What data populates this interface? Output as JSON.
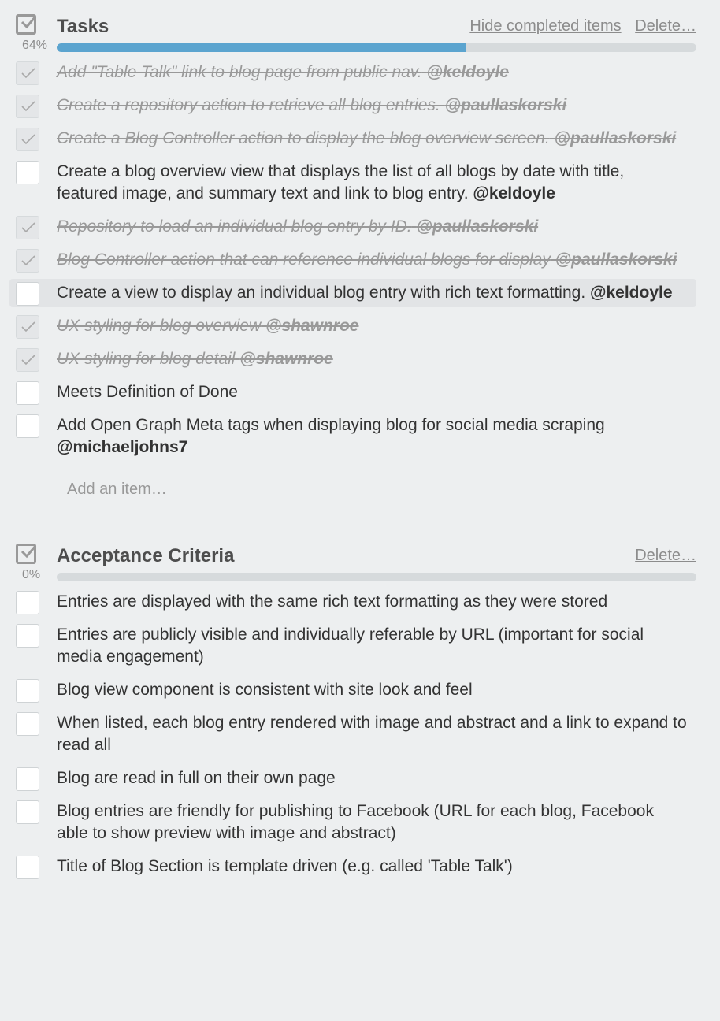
{
  "tasks": {
    "title": "Tasks",
    "hide_completed": "Hide completed items",
    "delete": "Delete…",
    "percent": "64%",
    "progress": 64,
    "items": [
      {
        "text": "Add \"Table Talk\" link to blog page from public nav.",
        "mention": "@keldoyle",
        "done": true
      },
      {
        "text": "Create a repository action to retrieve all blog entries.",
        "mention": "@paullaskorski",
        "done": true
      },
      {
        "text": "Create a Blog Controller action to display the blog overview screen.",
        "mention": "@paullaskorski",
        "done": true
      },
      {
        "text": "Create a blog overview view that displays the list of all blogs by date with title, featured image, and summary text and link to blog entry.",
        "mention": "@keldoyle",
        "done": false
      },
      {
        "text": "Repository to load an individual blog entry by ID.",
        "mention": "@paullaskorski",
        "done": true
      },
      {
        "text": "Blog Controller action that can reference individual blogs for display",
        "mention": "@paullaskorski",
        "done": true
      },
      {
        "text": "Create a view to display an individual blog entry with rich text formatting.",
        "mention": "@keldoyle",
        "done": false
      },
      {
        "text": "UX styling for blog overview",
        "mention": "@shawnroe",
        "done": true
      },
      {
        "text": "UX styling for blog detail",
        "mention": "@shawnroe",
        "done": true
      },
      {
        "text": "Meets Definition of Done",
        "mention": "",
        "done": false
      },
      {
        "text": "Add Open Graph Meta tags when displaying blog for social media scraping",
        "mention": "@michaeljohns7",
        "done": false
      }
    ],
    "add_item": "Add an item…"
  },
  "acceptance": {
    "title": "Acceptance Criteria",
    "delete": "Delete…",
    "percent": "0%",
    "progress": 0,
    "items": [
      {
        "text": "Entries are displayed with the same rich text formatting as they were stored",
        "mention": "",
        "done": false
      },
      {
        "text": "Entries are publicly visible and individually referable by URL (important for social media engagement)",
        "mention": "",
        "done": false
      },
      {
        "text": "Blog view component is consistent with site look and feel",
        "mention": "",
        "done": false
      },
      {
        "text": "When listed, each blog entry rendered with image and abstract and a link to expand to read all",
        "mention": "",
        "done": false
      },
      {
        "text": "Blog are read in full on their own page",
        "mention": "",
        "done": false
      },
      {
        "text": "Blog entries are friendly for publishing to Facebook (URL for each blog, Facebook able to show preview with image and abstract)",
        "mention": "",
        "done": false
      },
      {
        "text": "Title of Blog Section is template driven (e.g. called 'Table Talk')",
        "mention": "",
        "done": false
      }
    ]
  },
  "colors": {
    "progress_fill": "#5ba4cf",
    "track": "#d6dadc",
    "background": "#edeff0"
  }
}
